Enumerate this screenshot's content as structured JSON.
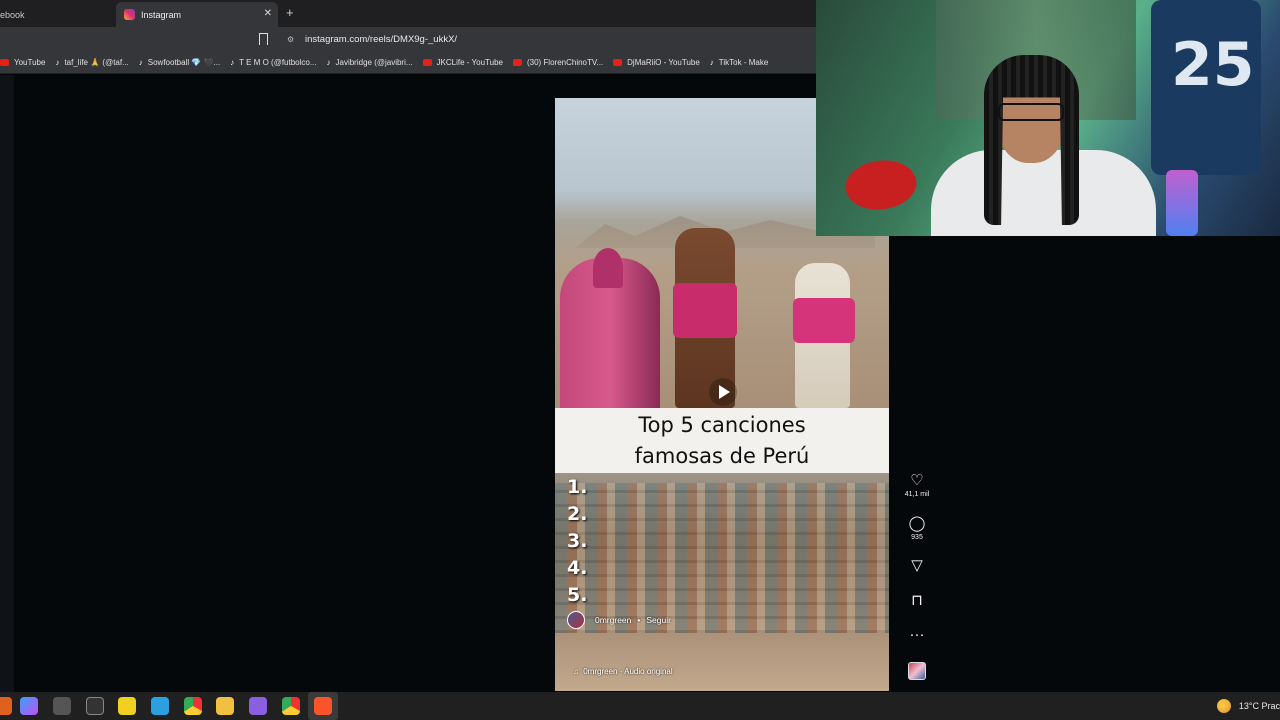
{
  "browser": {
    "tabs": [
      {
        "label": "ebook",
        "active": false
      },
      {
        "label": "Instagram",
        "active": true
      }
    ],
    "new_tab": "+",
    "close": "✕",
    "url": "instagram.com/reels/DMX9g-_ukkX/",
    "bookmarks": [
      {
        "label": "YouTube",
        "icon": "youtube-icon"
      },
      {
        "label": "taf_life 🙏 (@taf...",
        "icon": "tiktok-icon"
      },
      {
        "label": "Sowfootball 💎 🖤...",
        "icon": "tiktok-icon"
      },
      {
        "label": "T E M O (@futbolco...",
        "icon": "tiktok-icon"
      },
      {
        "label": "Javibridge (@javibri...",
        "icon": "tiktok-icon"
      },
      {
        "label": "JKCLife - YouTube",
        "icon": "youtube-icon"
      },
      {
        "label": "(30) FlorenChinoTV...",
        "icon": "youtube-icon"
      },
      {
        "label": "DjMaRiiO - YouTube",
        "icon": "youtube-icon"
      },
      {
        "label": "TikTok - Make",
        "icon": "tiktok-icon"
      }
    ]
  },
  "reel": {
    "caption_line1": "Top 5 canciones",
    "caption_line2": "famosas de Perú",
    "list": [
      "1.",
      "2.",
      "3.",
      "4.",
      "5."
    ],
    "author": "0mrgreen",
    "separator": "•",
    "follow": "Seguir",
    "audio": "0mrgreen · Audio original",
    "audio_icon": "♫"
  },
  "actions": {
    "likes": "41,1 mil",
    "comments": "935",
    "like_icon": "♡",
    "comment_icon": "◯",
    "share_icon": "▽",
    "save_icon": "⊓",
    "more_icon": "···"
  },
  "webcam": {
    "jersey_number": "25"
  },
  "taskbar": {
    "temperature": "13°C",
    "weather_text": "Prac"
  }
}
